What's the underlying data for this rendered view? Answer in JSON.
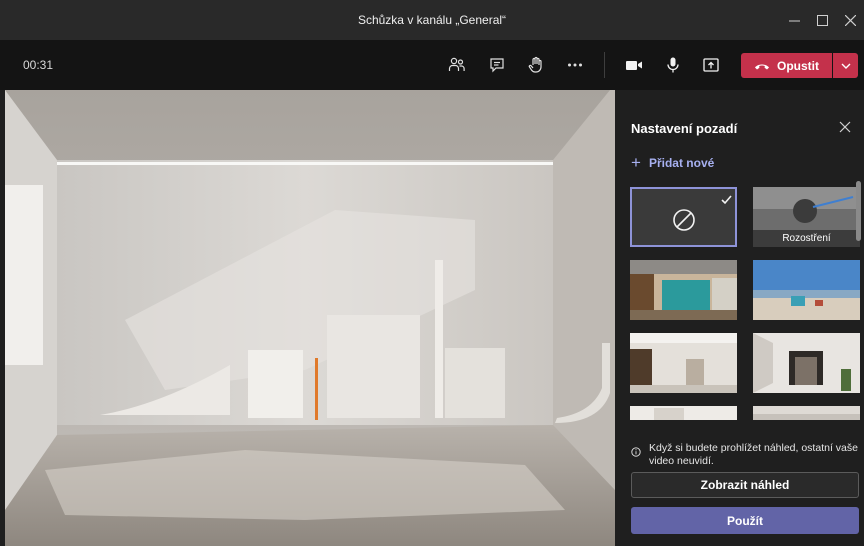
{
  "window": {
    "title": "Schůzka v kanálu „General“",
    "controls": [
      "minimize-icon",
      "maximize-icon",
      "close-icon"
    ]
  },
  "toolbar": {
    "timer": "00:31",
    "icons": [
      "participants-icon",
      "chat-icon",
      "raise-hand-icon",
      "more-options-icon",
      "camera-icon",
      "microphone-icon",
      "share-screen-icon"
    ],
    "leave_label": "Opustit",
    "leave_color": "#c4314b"
  },
  "panel": {
    "title": "Nastavení pozadí",
    "add_new_label": "Přidat nové",
    "blur_label": "Rozostření",
    "notice": "Když si budete prohlížet náhled, ostatní vaše video neuvidí.",
    "preview_label": "Zobrazit náhled",
    "apply_label": "Použít",
    "accent_color": "#6264a7"
  }
}
